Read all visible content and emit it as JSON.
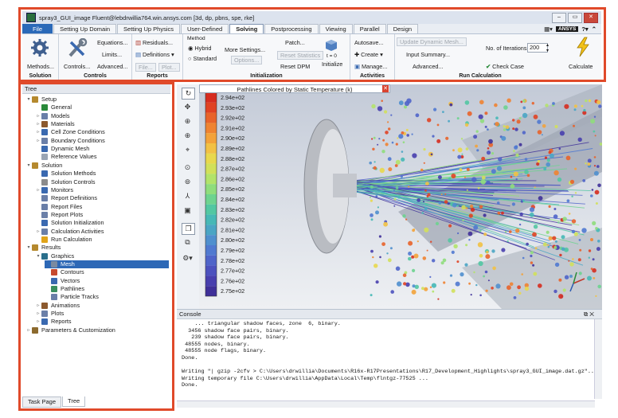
{
  "window": {
    "title": "spray3_GUI_image Fluent@lebdrwillia764.win.ansys.com  [3d, dp, pbns, spe, rke]"
  },
  "menu": {
    "tabs": [
      "File",
      "Setting Up Domain",
      "Setting Up Physics",
      "User-Defined",
      "Solving",
      "Postprocessing",
      "Viewing",
      "Parallel",
      "Design"
    ],
    "active": "Solving",
    "ansys_logo": "ANSYS"
  },
  "ribbon": {
    "solution": {
      "title": "Solution",
      "methods": "Methods..."
    },
    "controls": {
      "title": "Controls",
      "controls": "Controls...",
      "equations": "Equations...",
      "limits": "Limits...",
      "advanced": "Advanced..."
    },
    "reports": {
      "title": "Reports",
      "residuals": "Residuals...",
      "definitions": "Definitions",
      "file": "File...",
      "plot": "Plot..."
    },
    "initialization": {
      "title": "Initialization",
      "method_label": "Method",
      "hybrid": "Hybrid",
      "standard": "Standard",
      "more_settings": "More Settings...",
      "options": "Options...",
      "patch": "Patch...",
      "reset_statistics": "Reset Statistics",
      "reset_dpm": "Reset DPM",
      "t0": "t = 0",
      "initialize": "Initialize"
    },
    "activities": {
      "title": "Activities",
      "autosave": "Autosave...",
      "create": "Create",
      "manage": "Manage..."
    },
    "run_calc": {
      "title": "Run Calculation",
      "update_dynamic_mesh": "Update Dynamic Mesh...",
      "input_summary": "Input Summary...",
      "advanced": "Advanced...",
      "iterations_label": "No. of Iterations",
      "iterations_value": "200",
      "check_case": "Check Case",
      "calculate": "Calculate"
    }
  },
  "tree": {
    "header": "Tree",
    "nodes": [
      "Setup",
      "General",
      "Models",
      "Materials",
      "Cell Zone Conditions",
      "Boundary Conditions",
      "Dynamic Mesh",
      "Reference Values",
      "Solution",
      "Solution Methods",
      "Solution Controls",
      "Monitors",
      "Report Definitions",
      "Report Files",
      "Report Plots",
      "Solution Initialization",
      "Calculation Activities",
      "Run Calculation",
      "Results",
      "Graphics",
      "Mesh",
      "Contours",
      "Vectors",
      "Pathlines",
      "Particle Tracks",
      "Animations",
      "Plots",
      "Reports",
      "Parameters & Customization"
    ],
    "selected": "Mesh",
    "tabs": [
      "Task Page",
      "Tree"
    ]
  },
  "graphics": {
    "tab_title": "Pathlines Colored by Static Temperature (k)",
    "colorbar": [
      "2.94e+02",
      "2.93e+02",
      "2.92e+02",
      "2.91e+02",
      "2.90e+02",
      "2.89e+02",
      "2.88e+02",
      "2.87e+02",
      "2.86e+02",
      "2.85e+02",
      "2.84e+02",
      "2.83e+02",
      "2.82e+02",
      "2.81e+02",
      "2.80e+02",
      "2.79e+02",
      "2.78e+02",
      "2.77e+02",
      "2.76e+02",
      "2.75e+02"
    ],
    "colors": [
      "#d62c1f",
      "#e04223",
      "#e8632a",
      "#ef8331",
      "#f3a23a",
      "#f2c144",
      "#e8d84d",
      "#d1e05a",
      "#b2e36a",
      "#8fdd7c",
      "#6dd38f",
      "#52c7a2",
      "#46b8b6",
      "#4aa5c4",
      "#4f8fce",
      "#5079d0",
      "#4f64c9",
      "#4c51be",
      "#483fae",
      "#3f3099"
    ]
  },
  "console": {
    "title": "Console",
    "lines": [
      "    ... triangular shadow faces, zone  6, binary.",
      "  3456 shadow face pairs, binary.",
      "   239 shadow face pairs, binary.",
      " 48555 nodes, binary.",
      " 48555 node flags, binary.",
      "Done.",
      "",
      "Writing \"| gzip -2cfv > C:\\Users\\drwillia\\Documents\\R16x-R17Presentations\\R17_Development_Highlights\\spray3_GUI_image.dat.gz\"...",
      "Writing temporary file C:\\Users\\drwillia\\AppData\\Local\\Temp\\flntgz-77525 ...",
      "Done."
    ]
  }
}
